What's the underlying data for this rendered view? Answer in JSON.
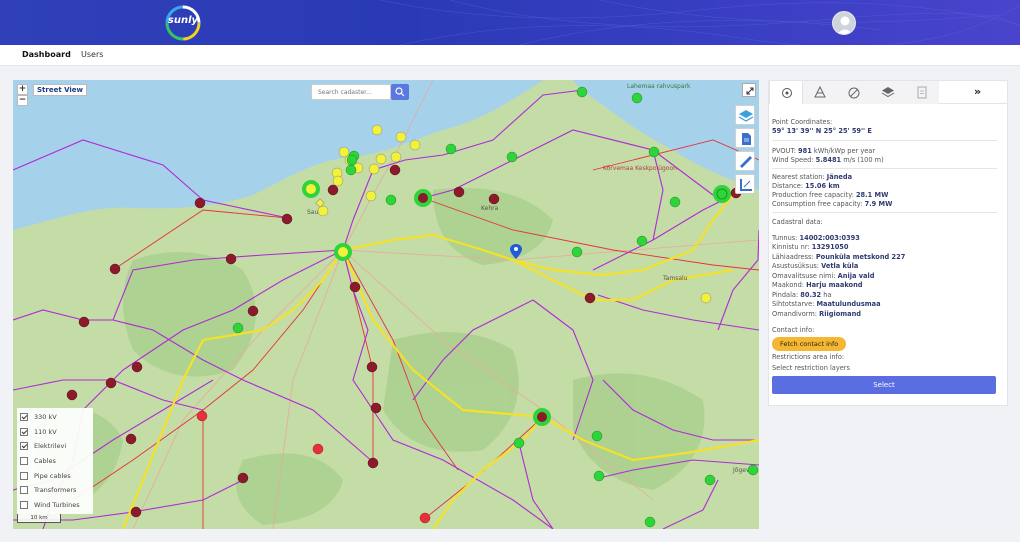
{
  "header": {
    "logo_text": "sunly"
  },
  "nav": {
    "items": [
      "Dashboard",
      "Users"
    ]
  },
  "map": {
    "street_view_label": "Street View",
    "search_placeholder": "Search cadaster...",
    "zoom_in": "+",
    "zoom_out": "−",
    "scale_label": "10 km",
    "place_labels": [
      "Saue",
      "Kehra",
      "Tamsalu",
      "Kõrvemaa Keskpolügoon",
      "Lahemaa rahvuspark",
      "Jõgeva"
    ],
    "legend": [
      {
        "label": "330 kV",
        "checked": true
      },
      {
        "label": "110 kV",
        "checked": true
      },
      {
        "label": "Elektrilevi",
        "checked": true
      },
      {
        "label": "Cables",
        "checked": false
      },
      {
        "label": "Pipe cables",
        "checked": false
      },
      {
        "label": "Transformers",
        "checked": false
      },
      {
        "label": "Wind Turbines",
        "checked": false
      }
    ]
  },
  "panel": {
    "expand": "»",
    "point_coordinates_label": "Point Coordinates:",
    "point_coordinates_value": "59° 13' 39'' N 25° 25' 59'' E",
    "pvout_label": "PVOUT:",
    "pvout_value": "981",
    "pvout_unit": "kWh/kWp per year",
    "wind_label": "Wind Speed:",
    "wind_value": "5.8481",
    "wind_unit": "m/s (100 m)",
    "station_label": "Nearest station:",
    "station_value": "Jäneda",
    "distance_label": "Distance:",
    "distance_value": "15.06 km",
    "production_label": "Production free capacity:",
    "production_value": "28.1 MW",
    "consumption_label": "Consumption free capacity:",
    "consumption_value": "7.9 MW",
    "cadastral_label": "Cadastral data:",
    "cadastral": [
      {
        "label": "Tunnus:",
        "value": "14002:003:0393"
      },
      {
        "label": "Kinnistu nr:",
        "value": "13291050"
      },
      {
        "label": "Lähiaadress:",
        "value": "Pounküla metskond 227"
      },
      {
        "label": "Asustusüksus:",
        "value": "Vetla küla"
      },
      {
        "label": "Omavalitsuse nimi:",
        "value": "Anija vald"
      },
      {
        "label": "Maakond:",
        "value": "Harju maakond"
      },
      {
        "label": "Pindala:",
        "value": "80.32",
        "unit": "ha"
      },
      {
        "label": "Sihtotstarve:",
        "value": "Maatulundusmaa"
      },
      {
        "label": "Omandivorm:",
        "value": "Riigiomand"
      }
    ],
    "contact_label": "Contact info:",
    "fetch_label": "Fetch contact info",
    "restrictions_label": "Restrictions area info:",
    "select_layers_label": "Select restriction layers",
    "select_button": "Select"
  },
  "colors": {
    "header": "#2f40b8",
    "accent": "#5b6ee1",
    "fetch": "#f5b731",
    "line_330": "#f5e12a",
    "line_110": "#b02ad8",
    "line_elektrilevi": "#e8303a",
    "station_green": "#2fd33a",
    "station_dark_red": "#8b1a2b",
    "station_yellow": "#f2f23a"
  }
}
